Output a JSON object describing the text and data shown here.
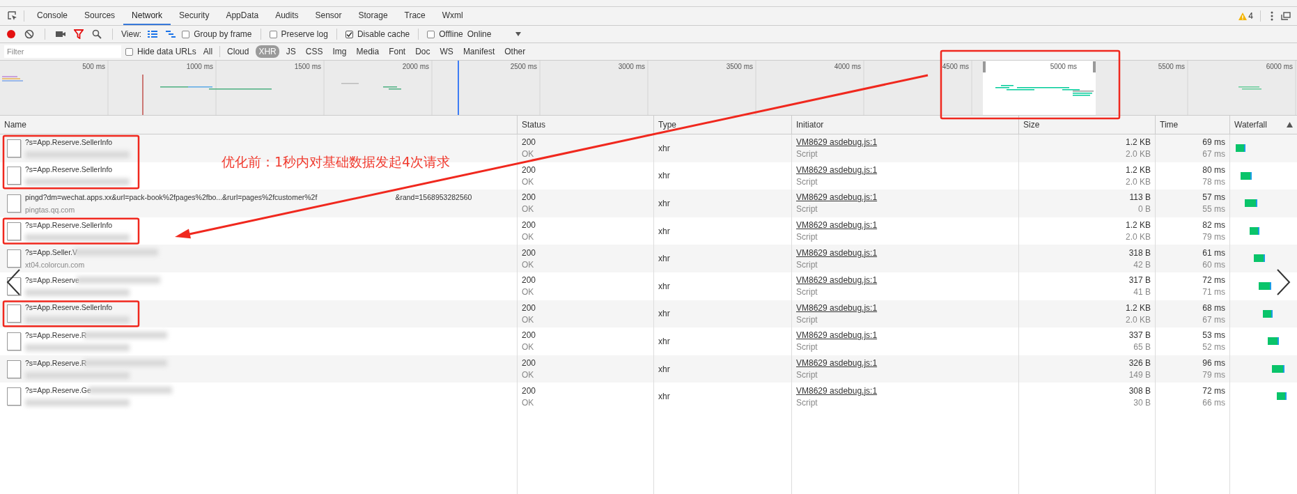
{
  "tabs": [
    {
      "label": "Console",
      "selected": false
    },
    {
      "label": "Sources",
      "selected": false
    },
    {
      "label": "Network",
      "selected": true
    },
    {
      "label": "Security",
      "selected": false
    },
    {
      "label": "AppData",
      "selected": false
    },
    {
      "label": "Audits",
      "selected": false
    },
    {
      "label": "Sensor",
      "selected": false
    },
    {
      "label": "Storage",
      "selected": false
    },
    {
      "label": "Trace",
      "selected": false
    },
    {
      "label": "Wxml",
      "selected": false
    }
  ],
  "warnings": {
    "count": "4"
  },
  "toolbar": {
    "recording": true,
    "filter_active": true,
    "view_label": "View:",
    "view_buttons": [
      {
        "kind": "list",
        "selected": true
      },
      {
        "kind": "overview",
        "selected": true
      }
    ],
    "checkboxes": [
      {
        "label": "Group by frame",
        "checked": false
      },
      {
        "label": "Preserve log",
        "checked": false
      },
      {
        "label": "Disable cache",
        "checked": true
      },
      {
        "label": "Offline",
        "checked": false
      }
    ],
    "throttling": "Online"
  },
  "filter_bar": {
    "placeholder": "Filter",
    "hide_data_urls": {
      "label": "Hide data URLs",
      "checked": false
    },
    "types": [
      {
        "label": "All",
        "selected": false
      },
      {
        "label": "Cloud",
        "selected": false
      },
      {
        "label": "XHR",
        "selected": true
      },
      {
        "label": "JS",
        "selected": false
      },
      {
        "label": "CSS",
        "selected": false
      },
      {
        "label": "Img",
        "selected": false
      },
      {
        "label": "Media",
        "selected": false
      },
      {
        "label": "Font",
        "selected": false
      },
      {
        "label": "Doc",
        "selected": false
      },
      {
        "label": "WS",
        "selected": false
      },
      {
        "label": "Manifest",
        "selected": false
      },
      {
        "label": "Other",
        "selected": false
      }
    ]
  },
  "timeline": {
    "ticks": [
      "500 ms",
      "1000 ms",
      "1500 ms",
      "2000 ms",
      "2500 ms",
      "3000 ms",
      "3500 ms",
      "4000 ms",
      "4500 ms",
      "5000 ms",
      "5500 ms",
      "6000 ms"
    ]
  },
  "table": {
    "columns": [
      {
        "label": "Name",
        "sorted": false
      },
      {
        "label": "Status",
        "sorted": false
      },
      {
        "label": "Type",
        "sorted": false
      },
      {
        "label": "Initiator",
        "sorted": false
      },
      {
        "label": "Size",
        "sorted": false
      },
      {
        "label": "Time",
        "sorted": false
      },
      {
        "label": "Waterfall",
        "sorted": true
      }
    ],
    "rows": [
      {
        "name": "?s=App.Reserve.SellerInfo",
        "name_redacted": false,
        "status": "200",
        "status_text": "OK",
        "type": "xhr",
        "initiator": "VM8629 asdebug.js:1",
        "initiator_type": "Script",
        "size": "1.2 KB",
        "content": "2.0 KB",
        "time": "69 ms",
        "latency": "67 ms",
        "highlighted": true
      },
      {
        "name": "?s=App.Reserve.SellerInfo",
        "name_redacted": false,
        "status": "200",
        "status_text": "OK",
        "type": "xhr",
        "initiator": "VM8629 asdebug.js:1",
        "initiator_type": "Script",
        "size": "1.2 KB",
        "content": "2.0 KB",
        "time": "80 ms",
        "latency": "78 ms",
        "highlighted": true
      },
      {
        "name": "pingd?dm=wechat.apps.xx&url=pack-book%2fpages%2fbo...&rurl=pages%2fcustomer%2f",
        "name_tail": "&rand=1568953282560",
        "domain": "pingtas.qq.com",
        "name_redacted": false,
        "status": "200",
        "status_text": "OK",
        "type": "xhr",
        "initiator": "VM8629 asdebug.js:1",
        "initiator_type": "Script",
        "size": "113 B",
        "content": "0 B",
        "time": "57 ms",
        "latency": "55 ms",
        "highlighted": false
      },
      {
        "name": "?s=App.Reserve.SellerInfo",
        "name_redacted": false,
        "status": "200",
        "status_text": "OK",
        "type": "xhr",
        "initiator": "VM8629 asdebug.js:1",
        "initiator_type": "Script",
        "size": "1.2 KB",
        "content": "2.0 KB",
        "time": "82 ms",
        "latency": "79 ms",
        "highlighted": true
      },
      {
        "name": "?s=App.Seller.V",
        "domain": "xt04.colorcun.com",
        "name_redacted": true,
        "status": "200",
        "status_text": "OK",
        "type": "xhr",
        "initiator": "VM8629 asdebug.js:1",
        "initiator_type": "Script",
        "size": "318 B",
        "content": "42 B",
        "time": "61 ms",
        "latency": "60 ms",
        "highlighted": false
      },
      {
        "name": "?s=App.Reserve",
        "name_redacted": true,
        "status": "200",
        "status_text": "OK",
        "type": "xhr",
        "initiator": "VM8629 asdebug.js:1",
        "initiator_type": "Script",
        "size": "317 B",
        "content": "41 B",
        "time": "72 ms",
        "latency": "71 ms",
        "highlighted": false
      },
      {
        "name": "?s=App.Reserve.SellerInfo",
        "name_redacted": false,
        "status": "200",
        "status_text": "OK",
        "type": "xhr",
        "initiator": "VM8629 asdebug.js:1",
        "initiator_type": "Script",
        "size": "1.2 KB",
        "content": "2.0 KB",
        "time": "68 ms",
        "latency": "67 ms",
        "highlighted": true
      },
      {
        "name": "?s=App.Reserve.R",
        "name_redacted": true,
        "status": "200",
        "status_text": "OK",
        "type": "xhr",
        "initiator": "VM8629 asdebug.js:1",
        "initiator_type": "Script",
        "size": "337 B",
        "content": "65 B",
        "time": "53 ms",
        "latency": "52 ms",
        "highlighted": false
      },
      {
        "name": "?s=App.Reserve.R",
        "name_redacted": true,
        "status": "200",
        "status_text": "OK",
        "type": "xhr",
        "initiator": "VM8629 asdebug.js:1",
        "initiator_type": "Script",
        "size": "326 B",
        "content": "149 B",
        "time": "96 ms",
        "latency": "79 ms",
        "highlighted": false
      },
      {
        "name": "?s=App.Reserve.Ge",
        "name_redacted": true,
        "status": "200",
        "status_text": "OK",
        "type": "xhr",
        "initiator": "VM8629 asdebug.js:1",
        "initiator_type": "Script",
        "size": "308 B",
        "content": "30 B",
        "time": "72 ms",
        "latency": "66 ms",
        "highlighted": false
      }
    ]
  },
  "annotation": {
    "text": "优化前：1秒内对基础数据发起4次请求"
  }
}
